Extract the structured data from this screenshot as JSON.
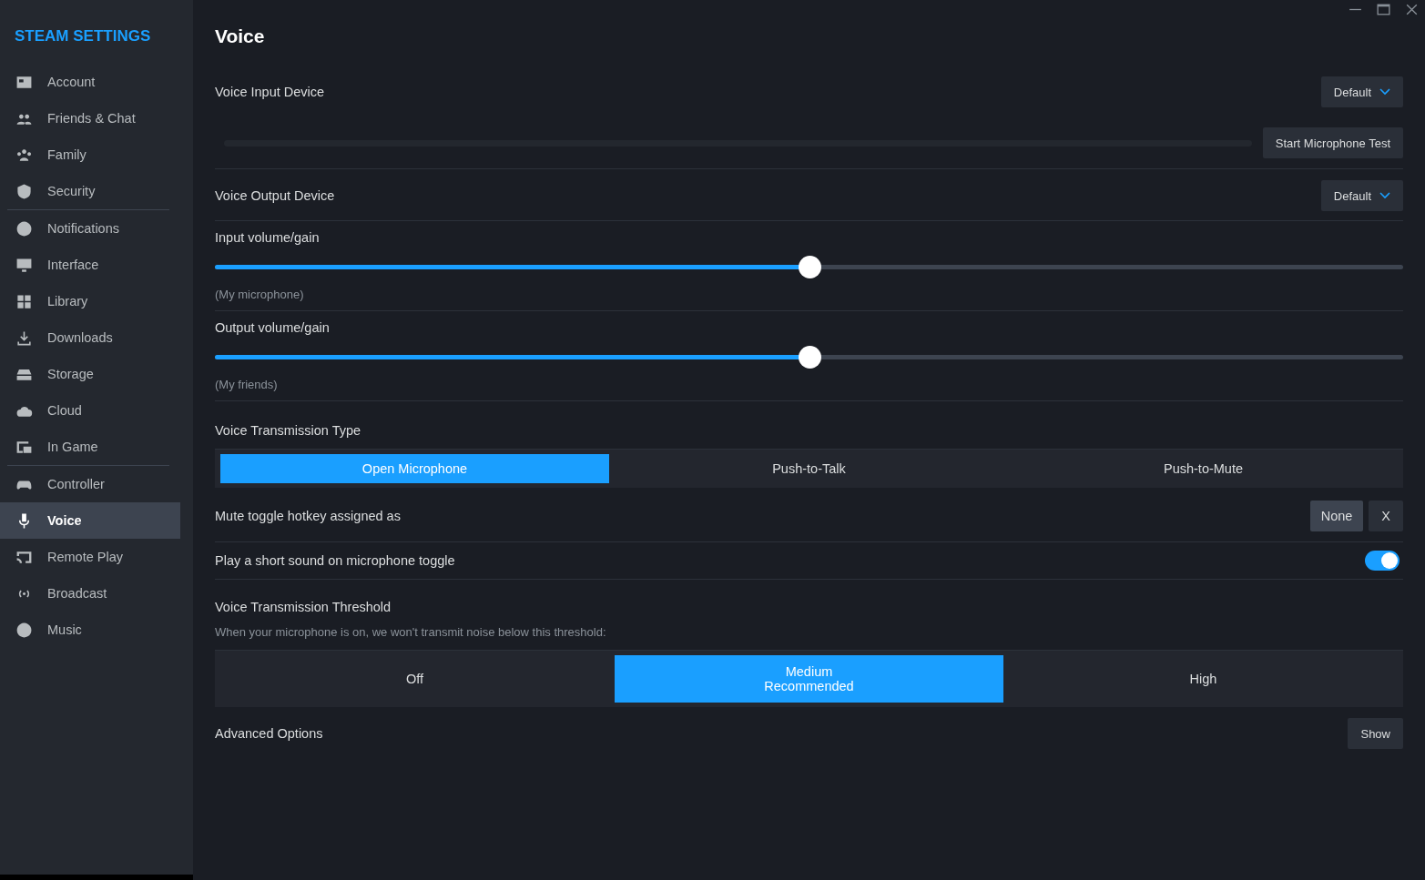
{
  "sidebar": {
    "title": "STEAM SETTINGS",
    "groups": [
      [
        {
          "label": "Account",
          "selected": false
        },
        {
          "label": "Friends & Chat",
          "selected": false
        },
        {
          "label": "Family",
          "selected": false
        },
        {
          "label": "Security",
          "selected": false
        }
      ],
      [
        {
          "label": "Notifications",
          "selected": false
        },
        {
          "label": "Interface",
          "selected": false
        },
        {
          "label": "Library",
          "selected": false
        },
        {
          "label": "Downloads",
          "selected": false
        },
        {
          "label": "Storage",
          "selected": false
        },
        {
          "label": "Cloud",
          "selected": false
        },
        {
          "label": "In Game",
          "selected": false
        }
      ],
      [
        {
          "label": "Controller",
          "selected": false
        },
        {
          "label": "Voice",
          "selected": true
        },
        {
          "label": "Remote Play",
          "selected": false
        },
        {
          "label": "Broadcast",
          "selected": false
        },
        {
          "label": "Music",
          "selected": false
        }
      ]
    ]
  },
  "page": {
    "title": "Voice",
    "input_device": {
      "label": "Voice Input Device",
      "value": "Default"
    },
    "mic_test": {
      "button": "Start Microphone Test"
    },
    "output_device": {
      "label": "Voice Output Device",
      "value": "Default"
    },
    "sliders": [
      {
        "label": "Input volume/gain",
        "level": 0.5,
        "note": "(My microphone)"
      },
      {
        "label": "Output volume/gain",
        "level": 0.5,
        "note": "(My friends)"
      }
    ],
    "transmission": {
      "label": "Voice Transmission Type",
      "options": [
        {
          "label": "Open Microphone",
          "selected": true
        },
        {
          "label": "Push-to-Talk",
          "selected": false
        },
        {
          "label": "Push-to-Mute",
          "selected": false
        }
      ]
    },
    "mute_hotkey": {
      "label": "Mute toggle hotkey assigned as",
      "value": "None",
      "clear": "X"
    },
    "toggle_sound": {
      "label": "Play a short sound on microphone toggle",
      "on": true
    },
    "threshold": {
      "label": "Voice Transmission Threshold",
      "description": "When your microphone is on, we won't transmit noise below this threshold:",
      "options": [
        {
          "label": "Off",
          "selected": false
        },
        {
          "label": "Medium",
          "note": "Recommended",
          "selected": true
        },
        {
          "label": "High",
          "selected": false
        }
      ]
    },
    "advanced": {
      "label": "Advanced Options",
      "button": "Show"
    }
  }
}
